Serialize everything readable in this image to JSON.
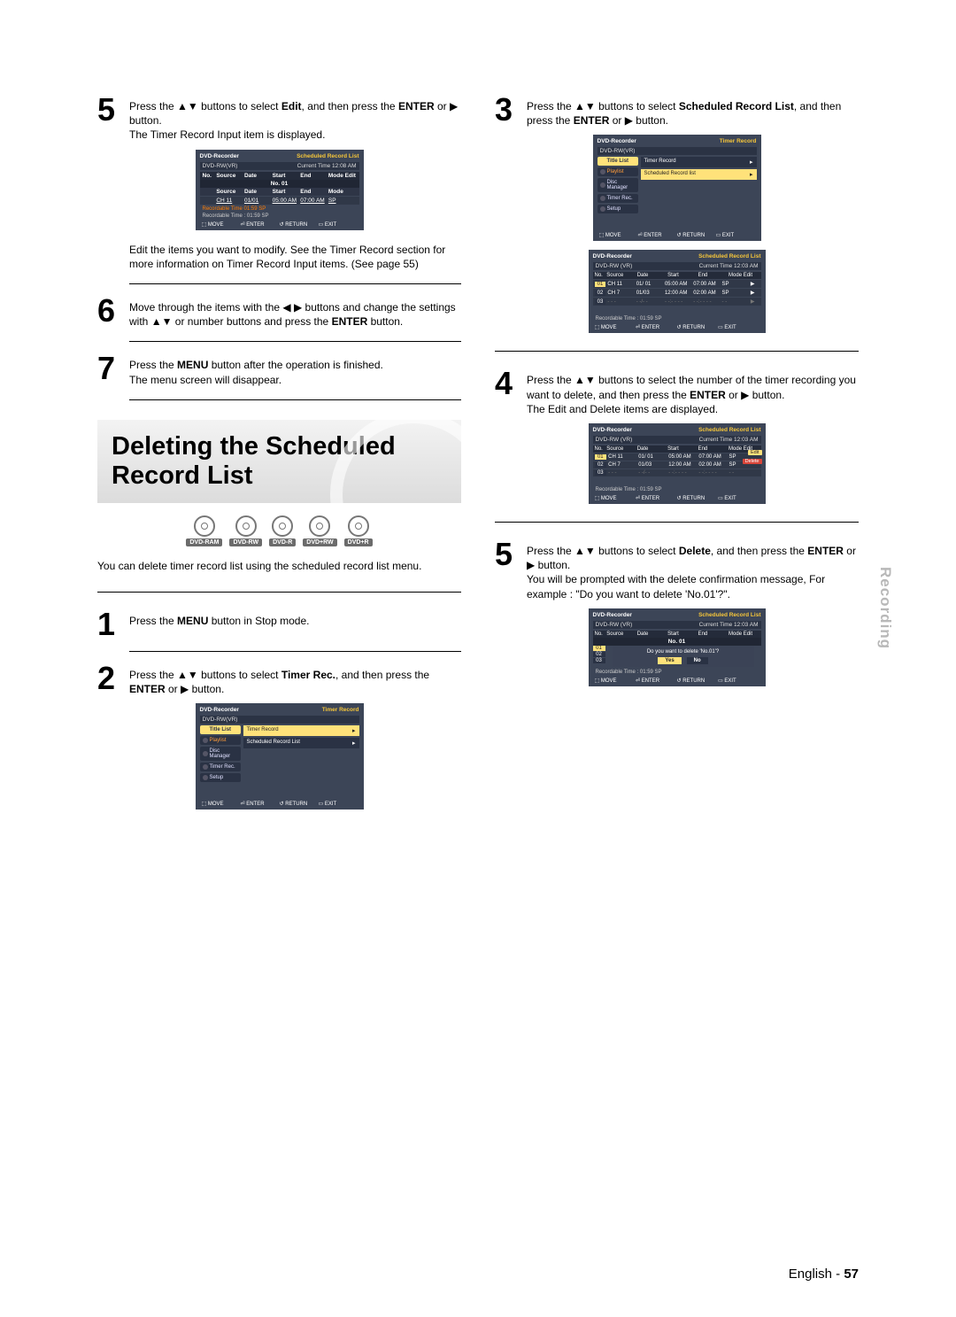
{
  "section_tab": "Recording",
  "page_footer": {
    "lang": "English -",
    "num": "57"
  },
  "left": {
    "step5": {
      "pre": "Press the ",
      "updown": "▲▼",
      "mid1": " buttons to select ",
      "bold1": "Edit",
      "mid2": ", and then press the ",
      "bold2": "ENTER",
      "mid3": " or ",
      "play": "▶",
      "mid4": " button.",
      "line2": "The Timer Record Input item is displayed."
    },
    "osd1": {
      "title": "DVD-Recorder",
      "right": "Scheduled Record List",
      "disc": "DVD-RW(VR)",
      "time": "Current Time  12:08 AM",
      "cols": [
        "No.",
        "Source",
        "Date",
        "Start",
        "End",
        "Mode Edit"
      ],
      "subbar": "No. 01",
      "cols2": [
        "",
        "Source",
        "Date",
        "Start",
        "End",
        "Mode"
      ],
      "row": [
        "",
        "CH 11",
        "01/01",
        "05:00 AM",
        "07:00 AM",
        "SP"
      ],
      "rec_orange": "Recordable Time 01:59  SP",
      "rec_white": "Recordable Time : 01:59  SP",
      "footer": [
        "⬚ MOVE",
        "⏎ ENTER",
        "↺ RETURN",
        "▭ EXIT"
      ]
    },
    "after_osd1": "Edit the items you want to modify. See the Timer Record section for more information on Timer Record Input items. (See page 55)",
    "step6": {
      "pre": "Move through the items with the ",
      "lr": "◀ ▶",
      "mid1": " buttons and change the settings with ",
      "ud": "▲▼",
      "mid2": " or number buttons and press the ",
      "bold": "ENTER",
      "end": " button."
    },
    "step7": {
      "pre": "Press the ",
      "bold": "MENU",
      "mid": " button after the operation is finished.",
      "line2": "The menu screen will disappear."
    },
    "del_heading_l1": "Deleting the Scheduled",
    "del_heading_l2": "Record List",
    "badges": [
      "DVD-RAM",
      "DVD-RW",
      "DVD-R",
      "DVD+RW",
      "DVD+R"
    ],
    "del_intro": "You can delete timer record list using the scheduled record list menu.",
    "step1": {
      "pre": "Press the ",
      "bold": "MENU",
      "end": " button in Stop mode."
    },
    "step2": {
      "pre": "Press the ",
      "ud": "▲▼",
      "mid1": " buttons to select ",
      "bold1": "Timer Rec.",
      "mid2": ", and then press the ",
      "bold2": "ENTER",
      "mid3": " or ",
      "play": "▶",
      "end": " button."
    },
    "osd_menu_left": {
      "title": "DVD-Recorder",
      "right": "Timer Record",
      "disc": "DVD-RW(VR)",
      "side": [
        {
          "t": "Title List",
          "state": "active"
        },
        {
          "t": "Playlist",
          "state": "orange"
        },
        {
          "t": "Disc Manager",
          "state": ""
        },
        {
          "t": "Timer Rec.",
          "state": ""
        },
        {
          "t": "Setup",
          "state": ""
        }
      ],
      "right_items": [
        {
          "t": "Timer Record",
          "active": true
        },
        {
          "t": "Scheduled Record List",
          "active": false
        }
      ],
      "footer": [
        "⬚ MOVE",
        "⏎ ENTER",
        "↺ RETURN",
        "▭ EXIT"
      ]
    }
  },
  "right": {
    "step3": {
      "pre": "Press the ",
      "ud": "▲▼",
      "mid1": " buttons to select ",
      "bold1": "Scheduled Record List",
      "mid2": ", and then press the ",
      "bold2": "ENTER",
      "mid3": " or ",
      "play": "▶",
      "end": " button."
    },
    "osd_menu_right": {
      "title": "DVD-Recorder",
      "right": "Timer Record",
      "disc": "DVD-RW(VR)",
      "side": [
        {
          "t": "Title List",
          "state": "active"
        },
        {
          "t": "Playlist",
          "state": "orange"
        },
        {
          "t": "Disc Manager",
          "state": ""
        },
        {
          "t": "Timer Rec.",
          "state": ""
        },
        {
          "t": "Setup",
          "state": ""
        }
      ],
      "right_items": [
        {
          "t": "Timer Record",
          "active": false
        },
        {
          "t": "Scheduled Record list",
          "active": true
        }
      ],
      "footer": [
        "⬚ MOVE",
        "⏎ ENTER",
        "↺ RETURN",
        "▭ EXIT"
      ]
    },
    "osd_list": {
      "title": "DVD-Recorder",
      "right": "Scheduled Record List",
      "disc": "DVD-RW (VR)",
      "time": "Current Time  12:03 AM",
      "cols": [
        "No.",
        "Source",
        "Date",
        "Start",
        "End",
        "Mode  Edit"
      ],
      "rows": [
        [
          "01",
          "CH 11",
          "01/ 01",
          "05:00 AM",
          "07:00 AM",
          "SP",
          "▶"
        ],
        [
          "02",
          "CH 7",
          "01/03",
          "12:00 AM",
          "02:00 AM",
          "SP",
          "▶"
        ],
        [
          "03",
          "- - -",
          "- -/- -",
          "- -:- - - -",
          "- -:- - - -",
          "- -",
          "▶"
        ]
      ],
      "rec": "Recordable Time :  01:59  SP",
      "footer": [
        "⬚ MOVE",
        "⏎ ENTER",
        "↺ RETURN",
        "▭ EXIT"
      ]
    },
    "step4": {
      "pre": "Press the ",
      "ud": "▲▼",
      "mid1": " buttons to select the number of the timer recording you want to delete, and then press the ",
      "bold": "ENTER",
      "mid2": " or ",
      "play": "▶",
      "end": " button.",
      "line2": "The Edit and Delete items are displayed."
    },
    "osd_list_popup": {
      "title": "DVD-Recorder",
      "right": "Scheduled Record List",
      "disc": "DVD-RW (VR)",
      "time": "Current Time  12:03 AM",
      "cols": [
        "No.",
        "Source",
        "Date",
        "Start",
        "End",
        "Mode  Edit"
      ],
      "rows": [
        [
          "01",
          "CH 11",
          "01/ 01",
          "05:00 AM",
          "07:00 AM",
          "SP"
        ],
        [
          "02",
          "CH 7",
          "01/03",
          "12:00 AM",
          "02:00 AM",
          "SP"
        ],
        [
          "03",
          "- - -",
          "- -/- -",
          "- -:- - - -",
          "- -:- - - -",
          "- -"
        ]
      ],
      "popup1": "Edit",
      "popup2": "Delete",
      "rec": "Recordable Time :  01:59  SP",
      "footer": [
        "⬚ MOVE",
        "⏎ ENTER",
        "↺ RETURN",
        "▭ EXIT"
      ]
    },
    "step5": {
      "pre": "Press the ",
      "ud": "▲▼",
      "mid1": " buttons to select ",
      "bold1": "Delete",
      "mid2": ", and then press the ",
      "bold2": "ENTER",
      "mid3": " or ",
      "play": "▶",
      "end": " button.",
      "line2": "You will be prompted with the delete confirmation message, For example : \"Do you want to delete 'No.01'?\"."
    },
    "osd_confirm": {
      "title": "DVD-Recorder",
      "right": "Scheduled Record List",
      "disc": "DVD-RW (VR)",
      "time": "Current Time  12:03 AM",
      "cols": [
        "No.",
        "Source",
        "Date",
        "Start",
        "End",
        "Mode  Edit"
      ],
      "subbar": "No. 01",
      "msg": "Do you want to delete 'No.01'?",
      "yes": "Yes",
      "no": "No",
      "nos": [
        "01",
        "02",
        "03"
      ],
      "rec": "Recordable Time :  01:59  SP",
      "footer": [
        "⬚ MOVE",
        "⏎ ENTER",
        "↺ RETURN",
        "▭ EXIT"
      ]
    }
  }
}
